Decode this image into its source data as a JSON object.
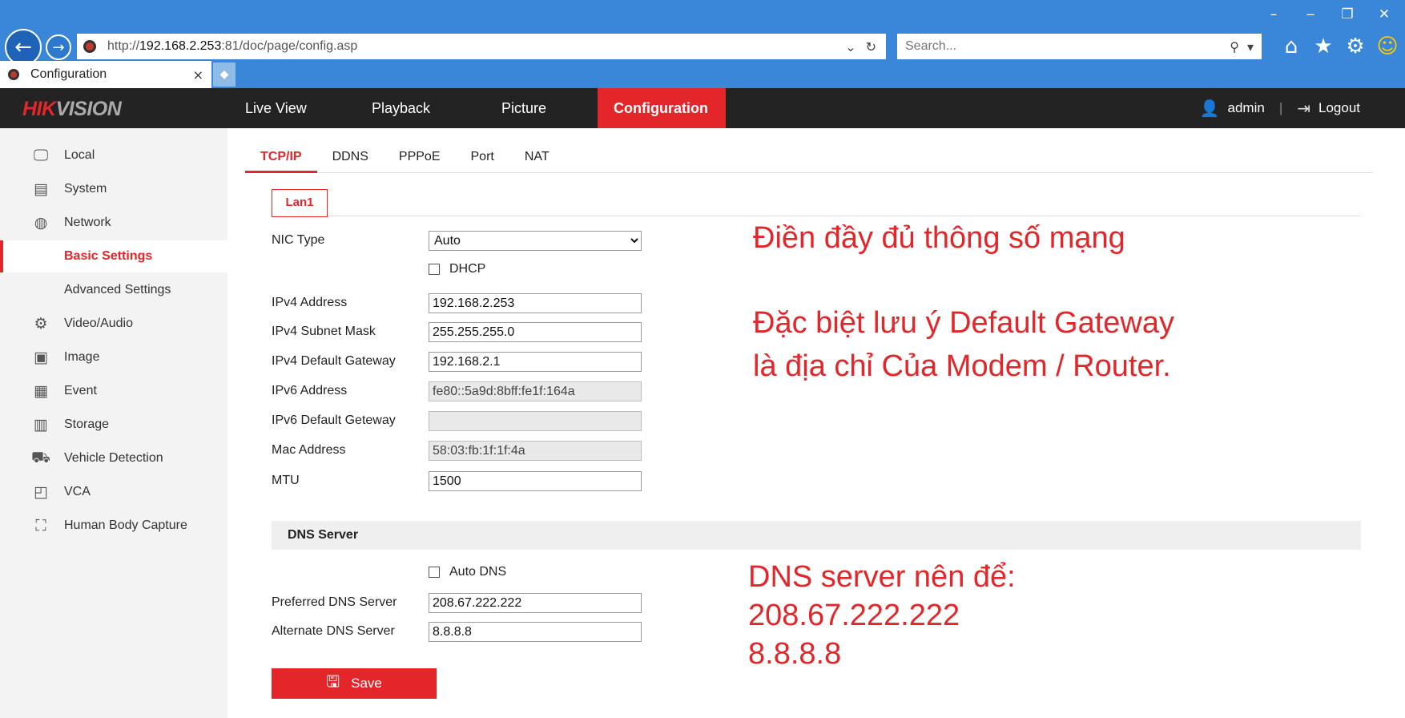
{
  "browser": {
    "url_prefix": "http://",
    "url_host": "192.168.2.253",
    "url_rest": ":81/doc/page/config.asp",
    "search_placeholder": "Search...",
    "tab_title": "Configuration",
    "icons": [
      "back-arrow-icon",
      "forward-arrow-icon",
      "refresh-icon",
      "search-icon",
      "home-icon",
      "star-icon",
      "gear-icon",
      "smiley-icon"
    ]
  },
  "header": {
    "logo_main": "HIK",
    "logo_accent": "VISION",
    "nav": [
      "Live View",
      "Playback",
      "Picture",
      "Configuration"
    ],
    "user": "admin",
    "logout": "Logout"
  },
  "sidebar": {
    "items": [
      {
        "label": "Local",
        "icon": "monitor-icon"
      },
      {
        "label": "System",
        "icon": "system-icon"
      },
      {
        "label": "Network",
        "icon": "globe-icon"
      },
      {
        "label": "Basic Settings",
        "icon": ""
      },
      {
        "label": "Advanced Settings",
        "icon": ""
      },
      {
        "label": "Video/Audio",
        "icon": "video-audio-icon"
      },
      {
        "label": "Image",
        "icon": "image-icon"
      },
      {
        "label": "Event",
        "icon": "event-icon"
      },
      {
        "label": "Storage",
        "icon": "storage-icon"
      },
      {
        "label": "Vehicle Detection",
        "icon": "vehicle-icon"
      },
      {
        "label": "VCA",
        "icon": "vca-icon"
      },
      {
        "label": "Human Body Capture",
        "icon": "human-body-icon"
      }
    ]
  },
  "subtabs": [
    "TCP/IP",
    "DDNS",
    "PPPoE",
    "Port",
    "NAT"
  ],
  "lan_tab": "Lan1",
  "form": {
    "nic_type": {
      "label": "NIC Type",
      "value": "Auto"
    },
    "dhcp": {
      "label": "DHCP",
      "checked": false
    },
    "ipv4_address": {
      "label": "IPv4 Address",
      "value": "192.168.2.253"
    },
    "ipv4_subnet": {
      "label": "IPv4 Subnet Mask",
      "value": "255.255.255.0"
    },
    "ipv4_gateway": {
      "label": "IPv4 Default Gateway",
      "value": "192.168.2.1"
    },
    "ipv6_address": {
      "label": "IPv6 Address",
      "value": "fe80::5a9d:8bff:fe1f:164a"
    },
    "ipv6_gateway": {
      "label": "IPv6 Default Geteway",
      "value": ""
    },
    "mac_address": {
      "label": "Mac Address",
      "value": "58:03:fb:1f:1f:4a"
    },
    "mtu": {
      "label": "MTU",
      "value": "1500"
    }
  },
  "dns": {
    "header": "DNS Server",
    "auto_dns": {
      "label": "Auto DNS",
      "checked": false
    },
    "preferred": {
      "label": "Preferred DNS Server",
      "value": "208.67.222.222"
    },
    "alternate": {
      "label": "Alternate DNS Server",
      "value": "8.8.8.8"
    }
  },
  "save_label": "Save",
  "annotations": {
    "note1": "Điền đầy đủ thông số mạng",
    "note2_line1": "Đặc biệt lưu ý Default Gateway",
    "note2_line2": "là địa chỉ Của Modem / Router.",
    "note3_line1": "DNS server nên để:",
    "note3_line2": "208.67.222.222",
    "note3_line3": "8.8.8.8"
  },
  "colors": {
    "accent": "#e2262a",
    "chrome_blue": "#3a86d8",
    "header_dark": "#232323"
  }
}
